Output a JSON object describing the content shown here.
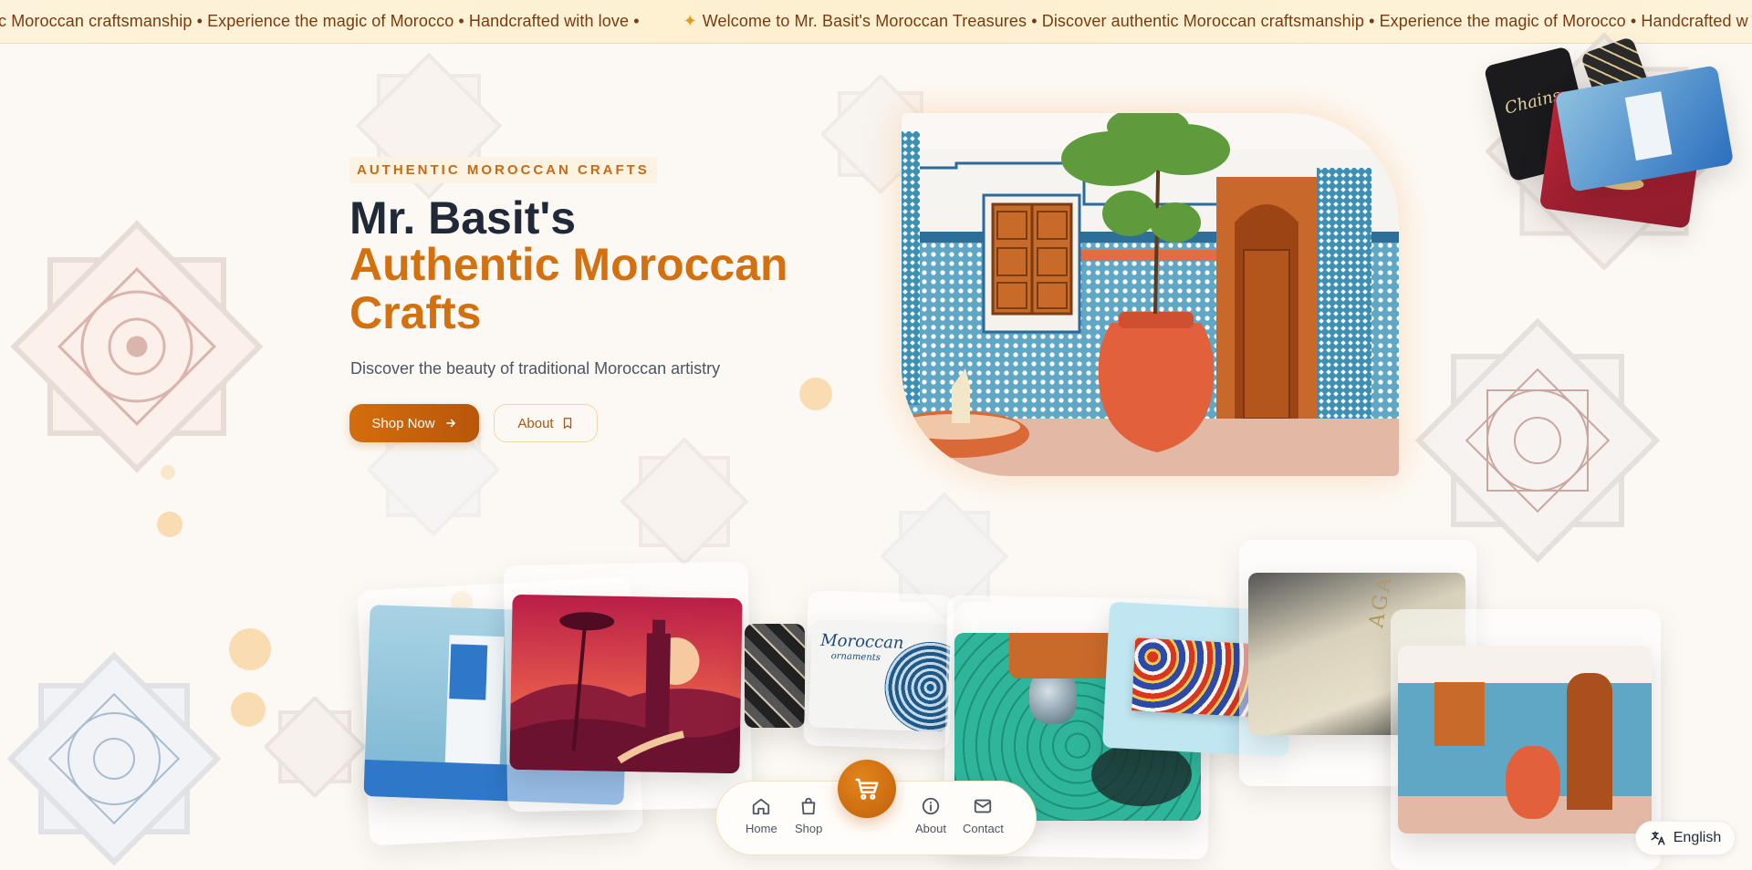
{
  "ticker": {
    "text_before": "c Moroccan craftsmanship • Experience the magic of Morocco • Handcrafted with love •",
    "star": "✦",
    "text_after": "Welcome to Mr. Basit's Moroccan Treasures • Discover authentic Moroccan craftsmanship • Experience the magic of Morocco • Handcrafted w"
  },
  "hero": {
    "tagline": "AUTHENTIC MOROCCAN CRAFTS",
    "title_line1": "Mr. Basit's",
    "title_line2": "Authentic Moroccan Crafts",
    "subtitle": "Discover the beauty of traditional Moroccan artistry",
    "shop_button": "Shop Now",
    "about_button": "About"
  },
  "cards": {
    "notebook_label": "Moroccan",
    "notebook_sub": "ornaments",
    "agadir_label": "AGADIR",
    "chains_label": "Chains"
  },
  "bottom_nav": {
    "home": "Home",
    "shop": "Shop",
    "about": "About",
    "contact": "Contact"
  },
  "language": {
    "label": "English"
  },
  "colors": {
    "accent": "#d3700f",
    "accent_dark": "#b8560b",
    "ticker_bg": "#fdf3da",
    "page_bg": "#fcf9f4"
  },
  "icons": [
    "arrow-right-icon",
    "bookmark-icon",
    "home-icon",
    "shopping-bag-icon",
    "cart-icon",
    "info-icon",
    "mail-icon",
    "translate-icon"
  ]
}
